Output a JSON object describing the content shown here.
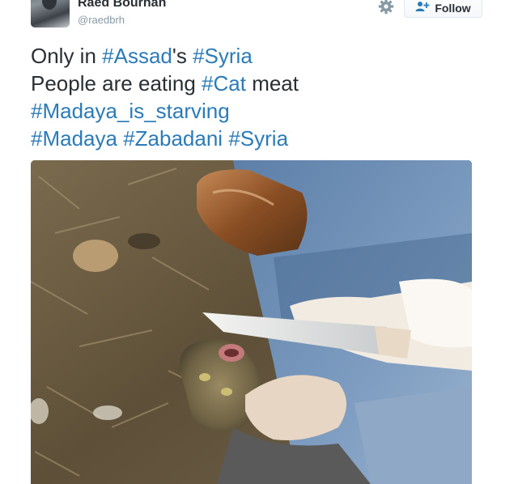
{
  "user": {
    "name": "Raed Bourhan",
    "handle": "@raedbrh"
  },
  "actions": {
    "follow_label": "Follow"
  },
  "tweet": {
    "lines": [
      [
        {
          "text": "Only in ",
          "hashtag": false
        },
        {
          "text": "#Assad",
          "hashtag": true
        },
        {
          "text": "'s ",
          "hashtag": false
        },
        {
          "text": "#Syria",
          "hashtag": true
        }
      ],
      [
        {
          "text": "People are eating ",
          "hashtag": false
        },
        {
          "text": "#Cat",
          "hashtag": true
        },
        {
          "text": " meat",
          "hashtag": false
        }
      ],
      [
        {
          "text": "#Madaya_is_starving",
          "hashtag": true
        }
      ],
      [
        {
          "text": "#Madaya",
          "hashtag": true
        },
        {
          "text": " ",
          "hashtag": false
        },
        {
          "text": "#Zabadani",
          "hashtag": true
        },
        {
          "text": " ",
          "hashtag": false
        },
        {
          "text": "#Syria",
          "hashtag": true
        }
      ]
    ]
  },
  "icons": {
    "settings": "gear-icon",
    "follow": "person-plus-icon"
  },
  "colors": {
    "hashtag": "#2b7bb9",
    "text": "#292f33",
    "handle": "#8899a6",
    "follow_border": "#e1e8ed"
  }
}
